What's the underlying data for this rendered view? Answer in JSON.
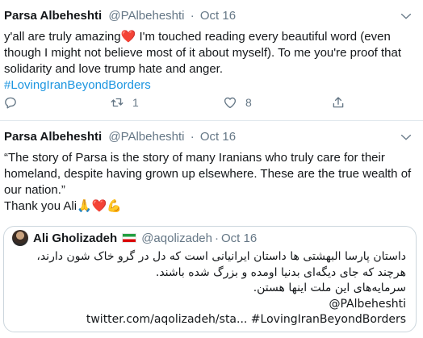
{
  "tweet1": {
    "name": "Parsa Albeheshti",
    "handle": "@PAlbeheshti",
    "separator": "·",
    "date": "Oct 16",
    "text_before_emoji": "y'all are truly amazing",
    "emoji": "❤️",
    "text_after_emoji": " I'm touched reading every beautiful word (even though I might not believe most of it about myself). To me you're proof that solidarity and love trump hate and anger.",
    "hashtag": "#LovingIranBeyondBorders",
    "actions": {
      "reply_count": "",
      "retweet_count": "1",
      "like_count": "8"
    }
  },
  "tweet2": {
    "name": "Parsa Albeheshti",
    "handle": "@PAlbeheshti",
    "separator": "·",
    "date": "Oct 16",
    "text": "“The story of Parsa is the story of many Iranians who truly care for their homeland, despite having grown up elsewhere. These are the true wealth of our nation.”",
    "thanks": "Thank you Ali",
    "emojis": "🙏❤️💪",
    "quote": {
      "name": "Ali Gholizadeh",
      "handle": "@aqolizadeh",
      "separator": "·",
      "date": "Oct 16",
      "line1": "داستان پارسا البهشتی ها داستان ایرانیانی است که دل در گرو خاک شون دارند،",
      "line2": "هرچند که جای دیگه‌ای بدنیا اومده و بزرگ شده باشند.",
      "line3": "سرمایه‌های این ملت اینها هستن.",
      "mention": "@PAlbeheshti",
      "link_line": "twitter.com/aqolizadeh/sta... #LovingIranBeyondBorders"
    }
  },
  "colors": {
    "text": "#14171a",
    "muted": "#657786",
    "link": "#1b95e0",
    "heart": "#e0245e",
    "border": "#e1e8ed"
  },
  "icons": [
    "chevron-down-icon",
    "reply-icon",
    "retweet-icon",
    "like-icon",
    "share-icon",
    "iran-flag-icon"
  ]
}
